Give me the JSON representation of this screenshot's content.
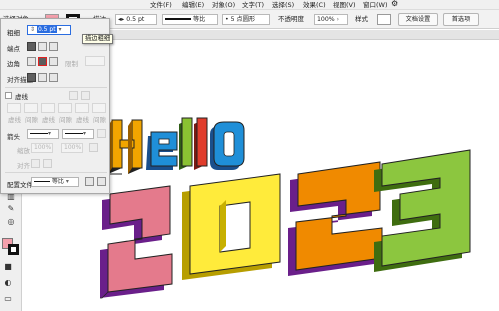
{
  "menubar": {
    "items": [
      "文件(F)",
      "编辑(E)",
      "对象(O)",
      "文字(T)",
      "选择(S)",
      "效果(C)",
      "视图(V)",
      "窗口(W)"
    ]
  },
  "controlbar": {
    "selection_label": "选择对象",
    "stroke_label": "描边",
    "stroke_weight": "0.5 pt",
    "profile_label": "等比",
    "brush_label": "5 点圆形",
    "opacity_label": "不透明度",
    "opacity_value": "100%",
    "style_label": "样式",
    "doc_settings_label": "文档设置",
    "preferences_label": "首选项",
    "fill_color": "#f4a0ac",
    "stroke_color": "#111111"
  },
  "stroke_panel": {
    "weight_label": "粗细",
    "weight_value": "0.5 pt",
    "cap_label": "端点",
    "corner_label": "边角",
    "limit_label": "限制",
    "align_label": "对齐描边",
    "dashed_label": "虚线",
    "dash_labels": [
      "虚线",
      "间隙",
      "虚线",
      "间隙",
      "虚线",
      "间隙"
    ],
    "arrow_label": "箭头",
    "scale_label": "缩放",
    "scale_values": [
      "100%",
      "100%"
    ],
    "align_arrow_label": "对齐",
    "profile_label": "配置文件",
    "profile_value": "等比",
    "tooltip": "描边粗细"
  },
  "artwork": {
    "hello_letters": [
      "H",
      "e",
      "l",
      "l",
      "o"
    ],
    "year_digits": [
      "2",
      "0",
      "2",
      "3"
    ],
    "colors": {
      "H": "#f2a500",
      "e": "#1f8fd8",
      "l1": "#8ac232",
      "l2": "#e03c2b",
      "o": "#1f8fd8",
      "d2a": "#e47a8c",
      "d0": "#ffeb3b",
      "d2b": "#f08a00",
      "d3": "#8cc63f",
      "extrude_purple": "#6a1f8a",
      "extrude_dark": "#2a2a2a"
    }
  },
  "icons": [
    "search-icon",
    "gear-icon",
    "dropdown-icon"
  ]
}
